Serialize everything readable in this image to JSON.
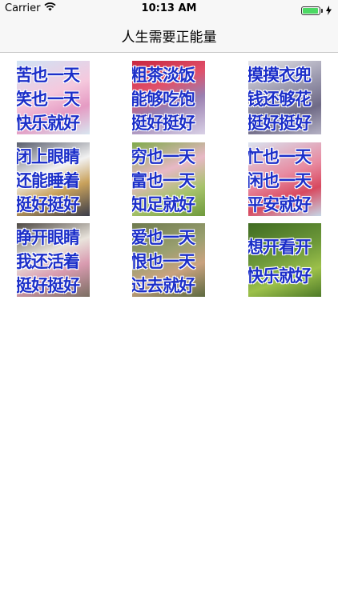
{
  "status": {
    "carrier": "Carrier",
    "time": "10:13 AM"
  },
  "nav": {
    "title": "人生需要正能量"
  },
  "tiles": [
    {
      "lines": [
        "苦也一天",
        "笑也一天",
        "快乐就好"
      ],
      "bg": "linear-gradient(160deg,#cfe3f5 0%,#f5c8dd 45%,#e59bc3 70%,#d8e6f0 100%)"
    },
    {
      "lines": [
        "粗茶淡饭",
        "能够吃饱",
        "挺好挺好"
      ],
      "bg": "linear-gradient(160deg,#c8263f 0%,#e0506a 35%,#9a7fb0 60%,#d9d1e6 100%)"
    },
    {
      "lines": [
        "摸摸衣兜",
        "钱还够花",
        "挺好挺好"
      ],
      "bg": "linear-gradient(160deg,#e6e6ea 0%,#9d9bb0 40%,#6f6a86 70%,#b5b2c4 100%)"
    },
    {
      "lines": [
        "闭上眼睛",
        "还能睡着",
        "挺好挺好"
      ],
      "bg": "linear-gradient(160deg,#5a5f6e 0%,#f2f2f2 40%,#c9a25c 65%,#3b3d4a 100%)"
    },
    {
      "lines": [
        "穷也一天",
        "富也一天",
        "知足就好"
      ],
      "bg": "linear-gradient(160deg,#7faa4a 0%,#e8b8c6 40%,#a6c26a 70%,#6f9a3c 100%)"
    },
    {
      "lines": [
        "忙也一天",
        "闲也一天",
        "平安就好"
      ],
      "bg": "linear-gradient(160deg,#d9e2ef 0%,#e88aa0 45%,#d8495f 70%,#c6d6e6 100%)"
    },
    {
      "lines": [
        "睁开眼睛",
        "我还活着",
        "挺好挺好"
      ],
      "bg": "linear-gradient(160deg,#4f4a45 0%,#e9e4dc 40%,#d99bb0 65%,#7b6e62 100%)"
    },
    {
      "lines": [
        "爱也一天",
        "恨也一天",
        "过去就好"
      ],
      "bg": "linear-gradient(160deg,#6e7a4e 0%,#9aa070 40%,#c9a27f 65%,#5d6a40 100%)"
    },
    {
      "lines": [
        "想开看开",
        "快乐就好",
        ""
      ],
      "bg": "linear-gradient(160deg,#3f6b22 0%,#6f9a3a 45%,#9cc04a 70%,#4e7a28 100%)"
    }
  ]
}
